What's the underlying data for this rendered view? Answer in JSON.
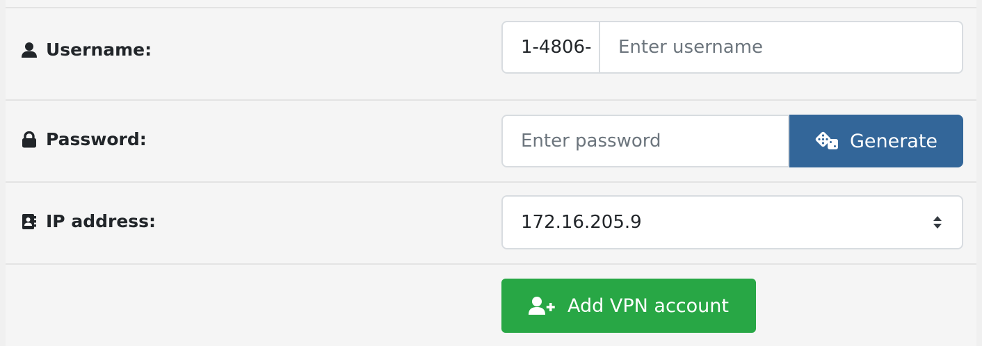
{
  "form": {
    "username": {
      "label": "Username:",
      "icon": "user-icon",
      "prefix": "1-4806-",
      "placeholder": "Enter username",
      "value": ""
    },
    "password": {
      "label": "Password:",
      "icon": "lock-icon",
      "placeholder": "Enter password",
      "value": "",
      "generate_label": "Generate",
      "generate_icon": "dice-icon"
    },
    "ip_address": {
      "label": "IP address:",
      "icon": "address-book-icon",
      "selected": "172.16.205.9",
      "caret_icon": "sort-caret-icon"
    },
    "submit": {
      "label": "Add VPN account",
      "icon": "user-plus-icon"
    }
  },
  "colors": {
    "generate_button": "#336699",
    "add_button": "#28a745",
    "border": "#d8dce0",
    "background": "#f5f5f5"
  }
}
